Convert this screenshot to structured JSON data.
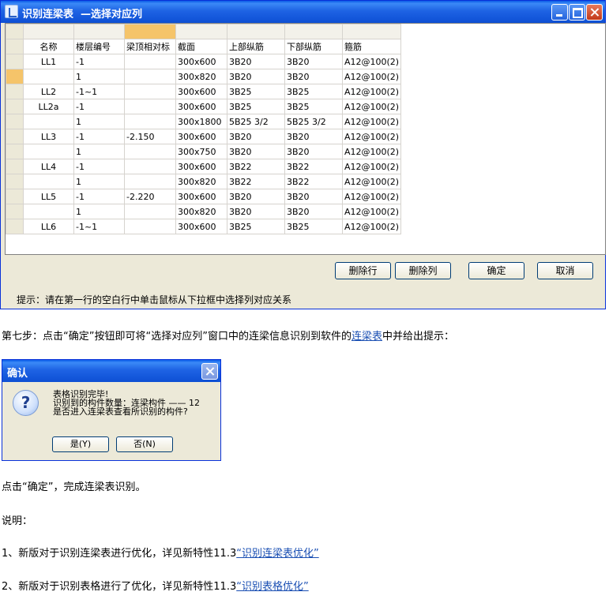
{
  "window": {
    "title": "识别连梁表  —选择对应列"
  },
  "grid": {
    "headers": [
      "名称",
      "楼层编号",
      "梁顶相对标",
      "截面",
      "上部纵筋",
      "下部纵筋",
      "箍筋"
    ],
    "rows": [
      [
        "LL1",
        "-1",
        "",
        "300x600",
        "3B20",
        "3B20",
        "A12@100(2)"
      ],
      [
        "",
        "1",
        "",
        "300x820",
        "3B20",
        "3B20",
        "A12@100(2)"
      ],
      [
        "LL2",
        "-1~1",
        "",
        "300x600",
        "3B25",
        "3B25",
        "A12@100(2)"
      ],
      [
        "LL2a",
        "-1",
        "",
        "300x600",
        "3B25",
        "3B25",
        "A12@100(2)"
      ],
      [
        "",
        "1",
        "",
        "300x1800",
        "5B25 3/2",
        "5B25 3/2",
        "A12@100(2)"
      ],
      [
        "LL3",
        "-1",
        "-2.150",
        "300x600",
        "3B20",
        "3B20",
        "A12@100(2)"
      ],
      [
        "",
        "1",
        "",
        "300x750",
        "3B20",
        "3B20",
        "A12@100(2)"
      ],
      [
        "LL4",
        "-1",
        "",
        "300x600",
        "3B22",
        "3B22",
        "A12@100(2)"
      ],
      [
        "",
        "1",
        "",
        "300x820",
        "3B22",
        "3B22",
        "A12@100(2)"
      ],
      [
        "LL5",
        "-1",
        "-2.220",
        "300x600",
        "3B20",
        "3B20",
        "A12@100(2)"
      ],
      [
        "",
        "1",
        "",
        "300x820",
        "3B20",
        "3B20",
        "A12@100(2)"
      ],
      [
        "LL6",
        "-1~1",
        "",
        "300x600",
        "3B25",
        "3B25",
        "A12@100(2)"
      ]
    ]
  },
  "buttons": {
    "delete_row": "删除行",
    "delete_col": "删除列",
    "ok": "确定",
    "cancel": "取消"
  },
  "hint": "提示：请在第一行的空白行中单击鼠标从下拉框中选择列对应关系",
  "step7": {
    "before": "第七步：点击“确定”按钮即可将“选择对应列”窗口中的连梁信息识别到软件的",
    "link": "连梁表",
    "after": "中并给出提示："
  },
  "dialog": {
    "title": "确认",
    "line1": "表格识别完毕!",
    "line2": "识别到的构件数量：连梁构件 —— 12",
    "line3": "是否进入连梁表查看所识别的构件?",
    "yes": "是(Y)",
    "no": "否(N)"
  },
  "para_done": "点击“确定”，完成连梁表识别。",
  "para_note": "说明：",
  "note1": {
    "text": "1、新版对于识别连梁表进行优化，详见新特性11.3",
    "link": "“识别连梁表优化”"
  },
  "note2": {
    "text": "2、新版对于识别表格进行了优化，详见新特性11.3",
    "link": "“识别表格优化”"
  },
  "colors": {
    "title_blue": "#0a5ae6",
    "selection_orange": "#f5c46a",
    "link_blue": "#1a4fb3"
  }
}
